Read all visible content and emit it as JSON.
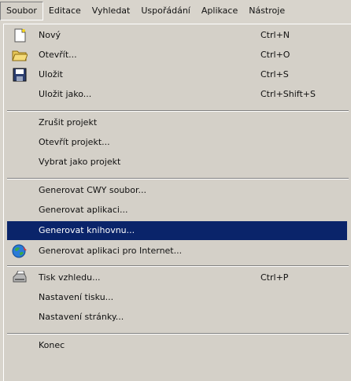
{
  "menubar": {
    "items": [
      {
        "label": "Soubor"
      },
      {
        "label": "Editace"
      },
      {
        "label": "Vyhledat"
      },
      {
        "label": "Uspořádání"
      },
      {
        "label": "Aplikace"
      },
      {
        "label": "Nástroje"
      }
    ]
  },
  "menu": {
    "items": [
      {
        "label": "Nový",
        "shortcut": "Ctrl+N",
        "icon": "new-document-icon"
      },
      {
        "label": "Otevřít...",
        "shortcut": "Ctrl+O",
        "icon": "open-folder-icon"
      },
      {
        "label": "Uložit",
        "shortcut": "Ctrl+S",
        "icon": "save-disk-icon"
      },
      {
        "label": "Uložit jako...",
        "shortcut": "Ctrl+Shift+S"
      },
      {
        "label": "Zrušit projekt"
      },
      {
        "label": "Otevřít projekt..."
      },
      {
        "label": "Vybrat jako projekt"
      },
      {
        "label": "Generovat CWY soubor..."
      },
      {
        "label": "Generovat aplikaci..."
      },
      {
        "label": "Generovat knihovnu...",
        "highlighted": true
      },
      {
        "label": "Generovat aplikaci pro Internet...",
        "icon": "internet-globe-icon"
      },
      {
        "label": "Tisk vzhledu...",
        "shortcut": "Ctrl+P",
        "icon": "printer-icon"
      },
      {
        "label": "Nastavení tisku..."
      },
      {
        "label": "Nastavení stránky..."
      },
      {
        "label": "Konec"
      }
    ]
  },
  "colors": {
    "menu_bg": "#d4d0c8",
    "highlight_bg": "#0a246a",
    "highlight_text": "#ffffff"
  }
}
